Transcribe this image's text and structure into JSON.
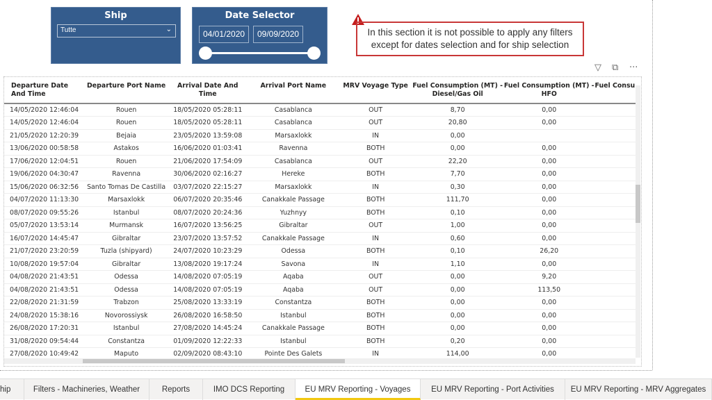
{
  "ship_slicer": {
    "title": "Ship",
    "value": "Tutte"
  },
  "date_selector": {
    "title": "Date Selector",
    "start": "04/01/2020",
    "end": "09/09/2020"
  },
  "warning": {
    "line1": "In this section it is not possible to apply any filters",
    "line2": "except for dates selection and for ship selection",
    "color": "#c83737"
  },
  "visual_icons": [
    "filter-icon",
    "focus-mode-icon",
    "more-options-icon"
  ],
  "table": {
    "columns": [
      "Departure Date And Time",
      "Departure Port Name",
      "Arrival Date And Time",
      "Arrival Port Name",
      "MRV Voyage Type",
      "Fuel Consumption (MT) - Diesel/Gas Oil",
      "Fuel Consumption (MT) - HFO",
      "Fuel Consu"
    ],
    "rows": [
      [
        "14/05/2020 12:46:04",
        "Rouen",
        "18/05/2020 05:28:11",
        "Casablanca",
        "OUT",
        "8,70",
        "0,00"
      ],
      [
        "14/05/2020 12:46:04",
        "Rouen",
        "18/05/2020 05:28:11",
        "Casablanca",
        "OUT",
        "20,80",
        "0,00"
      ],
      [
        "21/05/2020 12:20:39",
        "Bejaia",
        "23/05/2020 13:59:08",
        "Marsaxlokk",
        "IN",
        "0,00",
        ""
      ],
      [
        "13/06/2020 00:58:58",
        "Astakos",
        "16/06/2020 01:03:41",
        "Ravenna",
        "BOTH",
        "0,00",
        "0,00"
      ],
      [
        "17/06/2020 12:04:51",
        "Rouen",
        "21/06/2020 17:54:09",
        "Casablanca",
        "OUT",
        "22,20",
        "0,00"
      ],
      [
        "19/06/2020 04:30:47",
        "Ravenna",
        "30/06/2020 02:16:27",
        "Hereke",
        "BOTH",
        "7,70",
        "0,00"
      ],
      [
        "15/06/2020 06:32:56",
        "Santo Tomas De Castilla",
        "03/07/2020 22:15:27",
        "Marsaxlokk",
        "IN",
        "0,30",
        "0,00"
      ],
      [
        "04/07/2020 11:13:30",
        "Marsaxlokk",
        "06/07/2020 20:35:46",
        "Canakkale Passage",
        "BOTH",
        "111,70",
        "0,00"
      ],
      [
        "08/07/2020 09:55:26",
        "Istanbul",
        "08/07/2020 20:24:36",
        "Yuzhnyy",
        "BOTH",
        "0,10",
        "0,00"
      ],
      [
        "05/07/2020 13:53:14",
        "Murmansk",
        "16/07/2020 13:56:25",
        "Gibraltar",
        "OUT",
        "1,00",
        "0,00"
      ],
      [
        "16/07/2020 14:45:47",
        "Gibraltar",
        "23/07/2020 13:57:52",
        "Canakkale Passage",
        "IN",
        "0,60",
        "0,00"
      ],
      [
        "21/07/2020 23:20:59",
        "Tuzla (shipyard)",
        "24/07/2020 10:23:29",
        "Odessa",
        "BOTH",
        "0,10",
        "26,20"
      ],
      [
        "10/08/2020 19:57:04",
        "Gibraltar",
        "13/08/2020 19:17:24",
        "Savona",
        "IN",
        "1,10",
        "0,00"
      ],
      [
        "04/08/2020 21:43:51",
        "Odessa",
        "14/08/2020 07:05:19",
        "Aqaba",
        "OUT",
        "0,00",
        "9,20"
      ],
      [
        "04/08/2020 21:43:51",
        "Odessa",
        "14/08/2020 07:05:19",
        "Aqaba",
        "OUT",
        "0,00",
        "113,50"
      ],
      [
        "22/08/2020 21:31:59",
        "Trabzon",
        "25/08/2020 13:33:19",
        "Constantza",
        "BOTH",
        "0,00",
        "0,00"
      ],
      [
        "24/08/2020 15:38:16",
        "Novorossiysk",
        "26/08/2020 16:58:50",
        "Istanbul",
        "BOTH",
        "0,00",
        "0,00"
      ],
      [
        "26/08/2020 17:20:31",
        "Istanbul",
        "27/08/2020 14:45:24",
        "Canakkale Passage",
        "BOTH",
        "0,00",
        "0,00"
      ],
      [
        "31/08/2020 09:54:44",
        "Constantza",
        "01/09/2020 12:22:33",
        "Istanbul",
        "BOTH",
        "0,20",
        "0,00"
      ],
      [
        "27/08/2020 10:49:42",
        "Maputo",
        "02/09/2020 08:43:10",
        "Pointe Des Galets",
        "IN",
        "114,00",
        "0,00"
      ]
    ]
  },
  "tabs": [
    {
      "label": "hip",
      "active": false
    },
    {
      "label": "Filters - Machineries, Weather",
      "active": false
    },
    {
      "label": "Reports",
      "active": false
    },
    {
      "label": "IMO DCS Reporting",
      "active": false
    },
    {
      "label": "EU MRV Reporting - Voyages",
      "active": true
    },
    {
      "label": "EU MRV Reporting - Port Activities",
      "active": false
    },
    {
      "label": "EU MRV Reporting - MRV Aggregates",
      "active": false
    }
  ]
}
